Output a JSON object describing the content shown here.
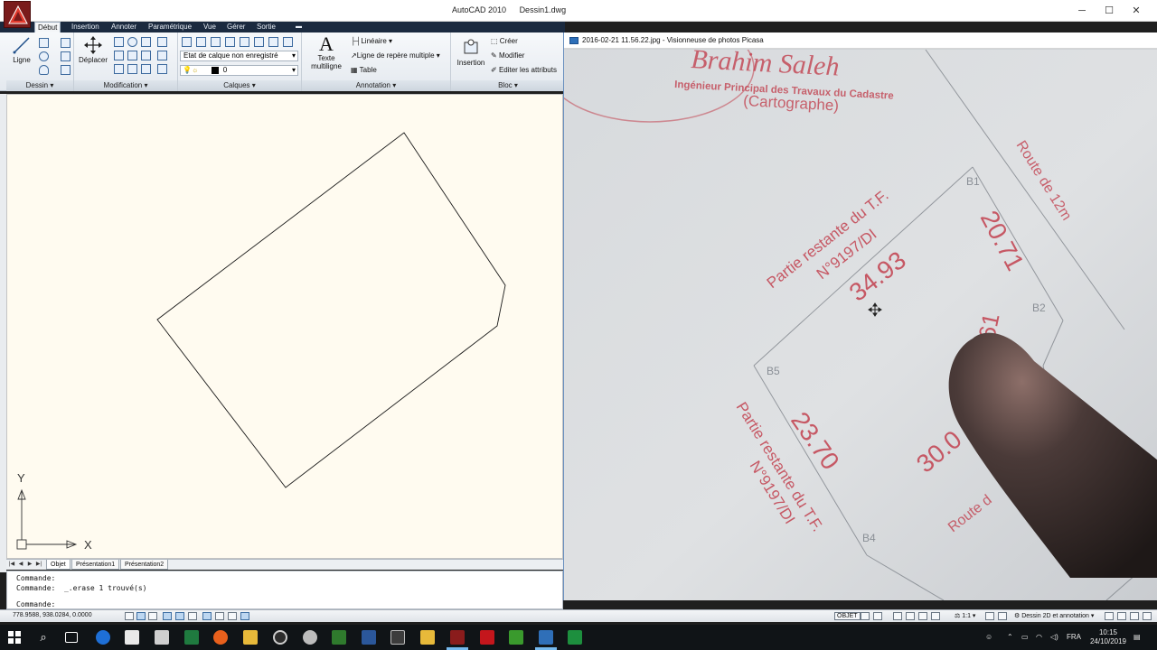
{
  "window": {
    "app_name": "AutoCAD 2010",
    "file_name": "Dessin1.dwg",
    "minimize": "─",
    "maximize": "☐",
    "close": "✕"
  },
  "ribbon": {
    "tabs": [
      "Début",
      "Insertion",
      "Annoter",
      "Paramétrique",
      "Vue",
      "Gérer",
      "Sortie"
    ],
    "groups": {
      "dessin": {
        "label": "Dessin",
        "ligne": "Ligne"
      },
      "modification": {
        "label": "Modification",
        "deplacer": "Déplacer"
      },
      "calques": {
        "label": "Calques",
        "etat": "Etat de calque non enregistré",
        "current_layer": "0"
      },
      "annotation": {
        "label": "Annotation",
        "texte_line1": "Texte",
        "texte_line2": "multiligne",
        "lineaire": "Linéaire",
        "ligne_repere": "Ligne de repère multiple",
        "table": "Table"
      },
      "bloc": {
        "label": "Bloc",
        "insertion": "Insertion",
        "creer": "Créer",
        "modifier": "Modifier",
        "editer": "Editer les attributs"
      }
    }
  },
  "ucs": {
    "y_label": "Y",
    "x_label": "X"
  },
  "layout_tabs": [
    "Objet",
    "Présentation1",
    "Présentation2"
  ],
  "command_line": {
    "line1": "Commande:",
    "line2": "Commande:  _.erase 1 trouvé(s)",
    "prompt": "Commande:"
  },
  "status": {
    "coords": "778.9588, 938.0284, 0.0000",
    "objet": "OBJET",
    "scale": "1:1",
    "workspace": "Dessin 2D et annotation"
  },
  "picasa": {
    "title": "2016-02-21 11.56.22.jpg - Visionneuse de photos Picasa",
    "stamp_name": "Brahim Saleh",
    "stamp_line2": "Ingénieur Principal des Travaux du Cadastre",
    "stamp_line3": "(Cartographe)",
    "parcel_top_1": "Partie restante du T.F.",
    "parcel_top_2": "N°9197/DI",
    "parcel_bottom_1": "Partie restante du T.F.",
    "parcel_bottom_2": "N°9197/DI",
    "route_12": "Route de 12m",
    "route_bottom": "Route d",
    "dim_1": "34.93",
    "dim_2": "20.71",
    "dim_3": "4.61",
    "dim_4": "23.70",
    "dim_5": "30.0",
    "b1": "B1",
    "b2": "B2",
    "b4": "B4",
    "b5": "B5"
  },
  "taskbar": {
    "time": "10:15",
    "date": "24/10/2019",
    "lang": "FRA"
  },
  "colors": {
    "ribbon_tab_bg": "#1b2a3f",
    "canvas_bg": "#fffbf0",
    "taskbar_bg": "#101417",
    "stamp_red": "#c2414f"
  }
}
